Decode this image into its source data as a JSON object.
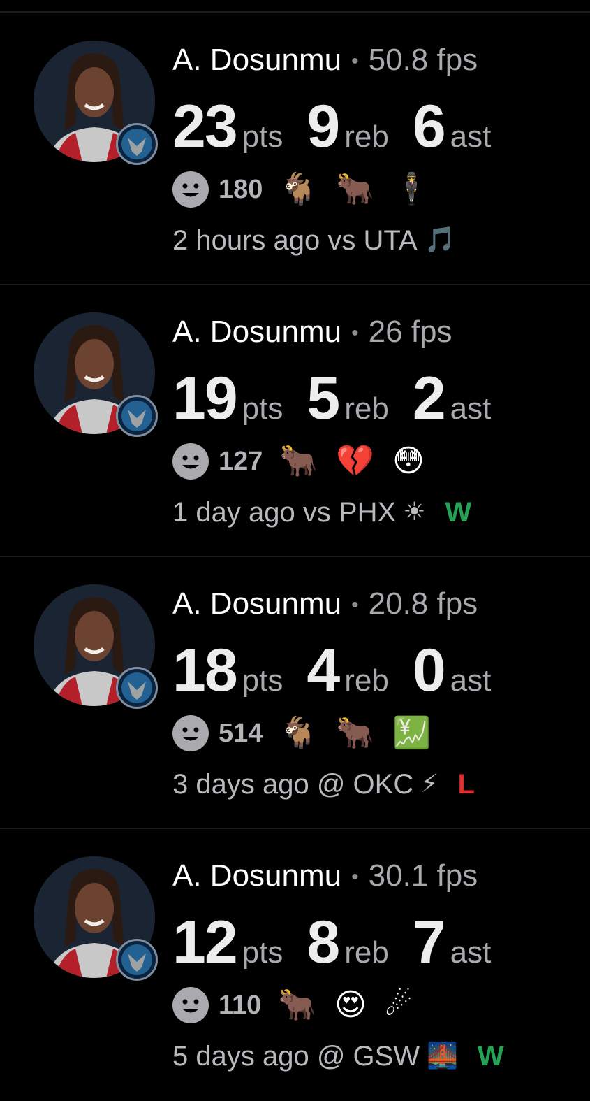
{
  "feed": [
    {
      "player": "A. Dosunmu",
      "fps": "50.8 fps",
      "pts": "23",
      "reb": "9",
      "ast": "6",
      "pts_label": "pts",
      "reb_label": "reb",
      "ast_label": "ast",
      "reaction_count": "180",
      "reactions": [
        "🐐",
        "🐂",
        "🕴"
      ],
      "time": "2 hours ago vs UTA",
      "opponent_logo": "🎵",
      "result": ""
    },
    {
      "player": "A. Dosunmu",
      "fps": "26 fps",
      "pts": "19",
      "reb": "5",
      "ast": "2",
      "pts_label": "pts",
      "reb_label": "reb",
      "ast_label": "ast",
      "reaction_count": "127",
      "reactions": [
        "🐂",
        "💔",
        "😳"
      ],
      "time": "1 day ago vs PHX",
      "opponent_logo": "☀",
      "result": "W"
    },
    {
      "player": "A. Dosunmu",
      "fps": "20.8 fps",
      "pts": "18",
      "reb": "4",
      "ast": "0",
      "pts_label": "pts",
      "reb_label": "reb",
      "ast_label": "ast",
      "reaction_count": "514",
      "reactions": [
        "🐐",
        "🐂",
        "💹"
      ],
      "time": "3 days ago @ OKC",
      "opponent_logo": "⚡",
      "result": "L"
    },
    {
      "player": "A. Dosunmu",
      "fps": "30.1 fps",
      "pts": "12",
      "reb": "8",
      "ast": "7",
      "pts_label": "pts",
      "reb_label": "reb",
      "ast_label": "ast",
      "reaction_count": "110",
      "reactions": [
        "🐂",
        "😍",
        "☄"
      ],
      "time": "5 days ago @ GSW",
      "opponent_logo": "🌉",
      "result": "W"
    }
  ],
  "colors": {
    "background": "#000000",
    "win": "#23a455",
    "loss": "#e0302b",
    "muted": "#a9a9ae"
  },
  "icons": {
    "reaction": "smiley-icon",
    "team_badge": "timberwolves-badge-icon"
  }
}
